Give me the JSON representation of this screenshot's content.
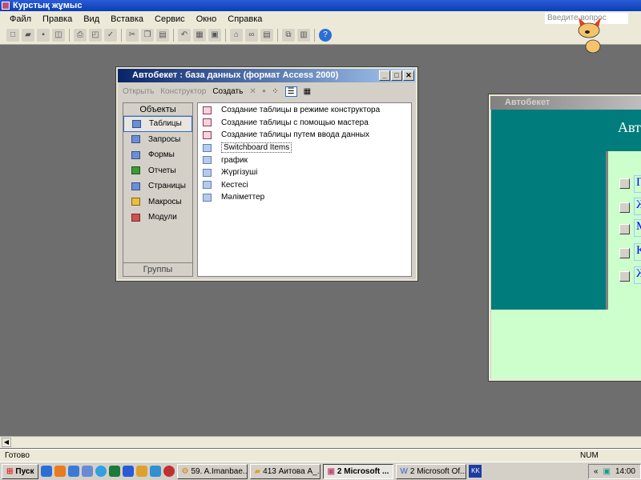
{
  "app": {
    "title": "Курстық жұмыс",
    "ask_placeholder": "Введите вопрос"
  },
  "menu": [
    "Файл",
    "Правка",
    "Вид",
    "Вставка",
    "Сервис",
    "Окно",
    "Справка"
  ],
  "db_window": {
    "title": "Автобекет : база данных (формат Access 2000)",
    "toolbar": {
      "open": "Открыть",
      "design": "Конструктор",
      "create": "Создать"
    },
    "objects_header": "Объекты",
    "groups": "Группы",
    "objects": [
      "Таблицы",
      "Запросы",
      "Формы",
      "Отчеты",
      "Страницы",
      "Макросы",
      "Модули"
    ],
    "items": [
      {
        "label": "Создание таблицы в режиме конструктора",
        "type": "wizard"
      },
      {
        "label": "Создание таблицы с помощью мастера",
        "type": "wizard"
      },
      {
        "label": "Создание таблицы путем ввода данных",
        "type": "wizard"
      },
      {
        "label": "Switchboard Items",
        "type": "table"
      },
      {
        "label": "график",
        "type": "table"
      },
      {
        "label": "Жүргізуші",
        "type": "table"
      },
      {
        "label": "Кестесі",
        "type": "table"
      },
      {
        "label": "Мәліметтер",
        "type": "table"
      }
    ]
  },
  "form_window": {
    "title": "Автобекет",
    "heading": "Авт",
    "buttons": [
      "Г",
      "Ж",
      "М",
      "К",
      "Ж"
    ]
  },
  "status": {
    "text": "Готово",
    "num": "NUM"
  },
  "taskbar": {
    "start": "Пуск",
    "tasks": [
      "59. A.Imanbae...",
      "413 Аитова А_...",
      "2 Microsoft ...",
      "2 Microsoft Of..."
    ],
    "lang": "KK",
    "clock": "14:00"
  }
}
